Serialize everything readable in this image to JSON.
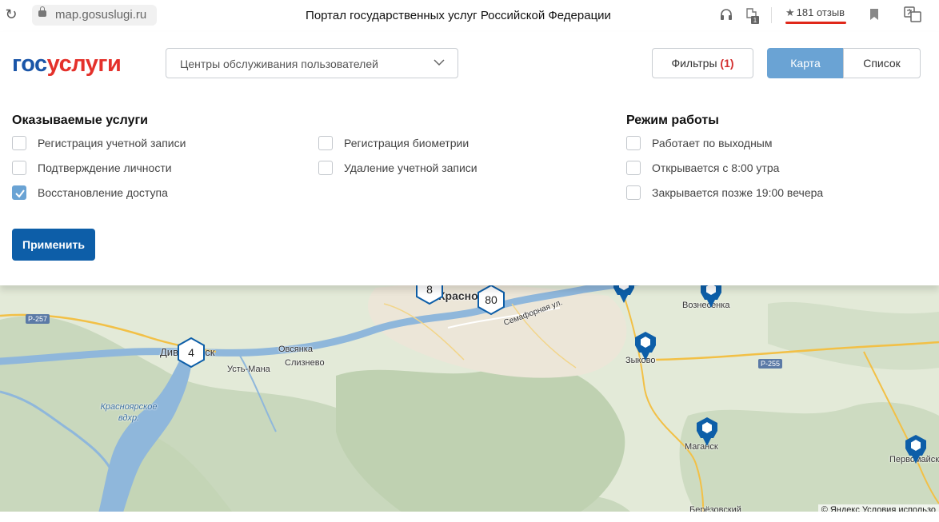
{
  "browser": {
    "url": "map.gosuslugi.ru",
    "page_title": "Портал государственных услуг Российской Федерации",
    "reviews": "181 отзыв",
    "reviews_star": "★"
  },
  "header": {
    "logo_part1": "гос",
    "logo_part2": "услуги",
    "select_value": "Центры обслуживания пользователей",
    "filters_label": "Фильтры",
    "filters_count": "(1)",
    "view_map": "Карта",
    "view_list": "Список"
  },
  "filters": {
    "services_title": "Оказываемые услуги",
    "services": [
      {
        "label": "Регистрация учетной записи",
        "checked": false
      },
      {
        "label": "Подтверждение личности",
        "checked": false
      },
      {
        "label": "Восстановление доступа",
        "checked": true
      },
      {
        "label": "Регистрация биометрии",
        "checked": false
      },
      {
        "label": "Удаление учетной записи",
        "checked": false
      }
    ],
    "schedule_title": "Режим работы",
    "schedule": [
      {
        "label": "Работает по выходным",
        "checked": false
      },
      {
        "label": "Открывается с 8:00 утра",
        "checked": false
      },
      {
        "label": "Закрывается позже 19:00 вечера",
        "checked": false
      }
    ],
    "apply_label": "Применить"
  },
  "map": {
    "clusters": [
      "8",
      "80",
      "4"
    ],
    "place_labels": [
      "Краснo",
      "Вознесенка",
      "Зыково",
      "Дивногорск",
      "Овсянка",
      "Усть-Мана",
      "Слизнево",
      "Семафорная ул.",
      "Маганск",
      "Первомайск",
      "Берёзовский"
    ],
    "water_label": "Красноярское вдхр.",
    "road_labels": [
      "Р-257",
      "Р-255"
    ],
    "copyright_prefix": "© Яндекс",
    "copyright_link": "Условия использо"
  },
  "colors": {
    "brand_blue": "#1a55a8",
    "brand_red": "#e4312b",
    "accent": "#6aa3d4",
    "apply_button": "#0d5ea8",
    "pin": "#0d5ea8"
  }
}
